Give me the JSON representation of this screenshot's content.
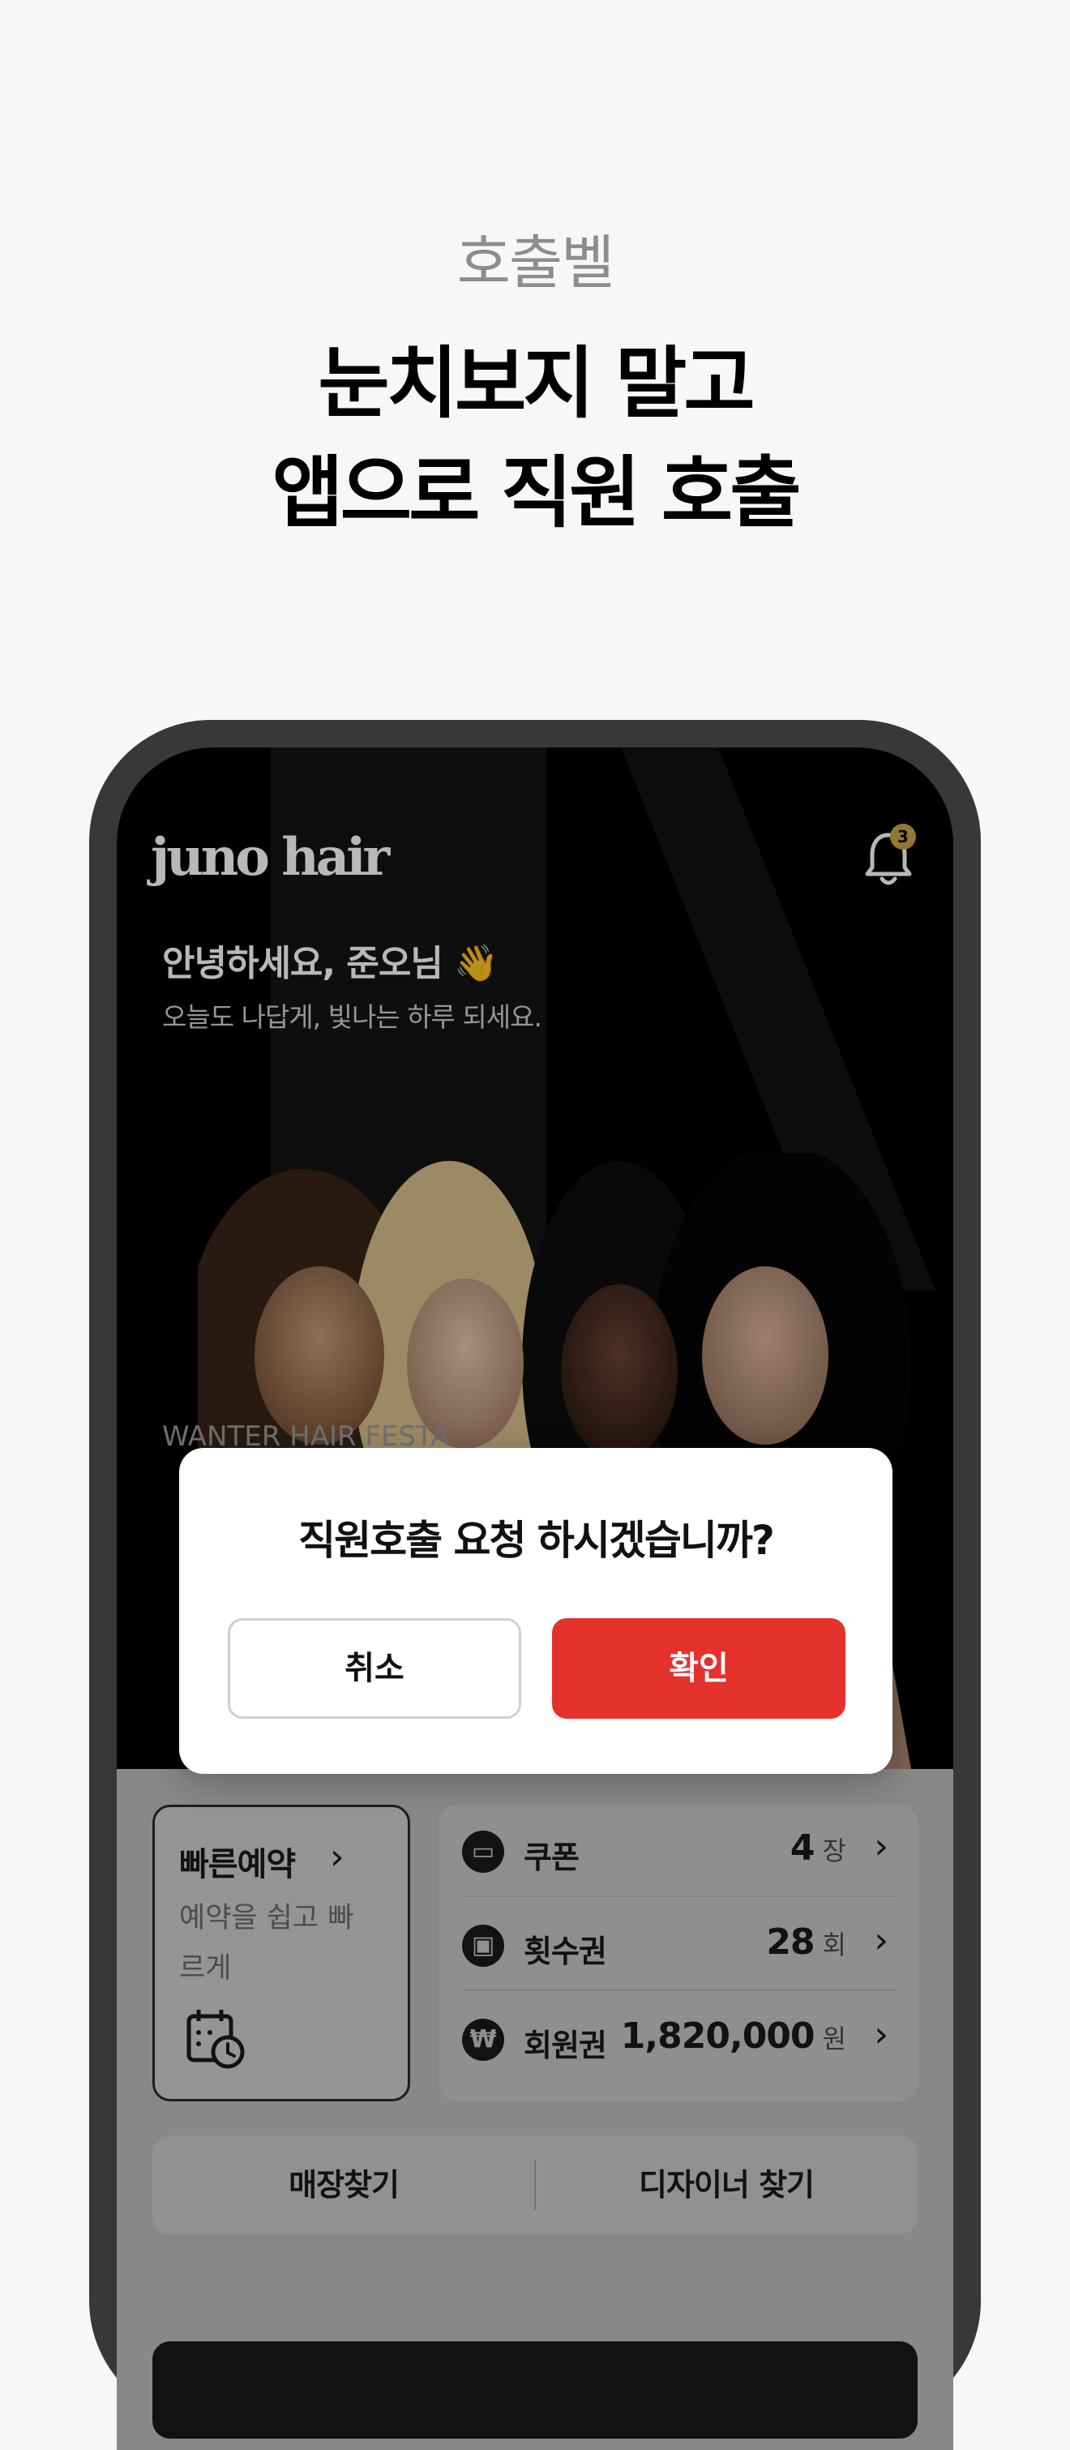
{
  "promo": {
    "eyebrow": "호출벨",
    "headline_line1": "눈치보지 말고",
    "headline_line2": "앱으로 직원 호출"
  },
  "app": {
    "brand": "juno hair",
    "notification_count": "3",
    "greeting": "안녕하세요, 준오님 👋",
    "subgreeting": "오늘도 나답게, 빛나는 하루 되세요.",
    "event_caption": "WANTER HAIR FESTA"
  },
  "quick_reserve": {
    "title": "빠른예약",
    "description": "예약을 쉽고 빠르게"
  },
  "wallet": [
    {
      "icon": "ticket-icon",
      "glyph": "▭",
      "label": "쿠폰",
      "value": "4",
      "unit": "장"
    },
    {
      "icon": "wallet-icon",
      "glyph": "▣",
      "label": "횟수권",
      "value": "28",
      "unit": "회"
    },
    {
      "icon": "won-icon",
      "glyph": "₩",
      "label": "회원권",
      "value": "1,820,000",
      "unit": "원"
    }
  ],
  "find": {
    "store": "매장찾기",
    "designer": "디자이너 찾기"
  },
  "dialog": {
    "title": "직원호출 요청 하시겠습니까?",
    "cancel": "취소",
    "confirm": "확인"
  },
  "colors": {
    "accent": "#e5312c",
    "badge": "#c9a449"
  }
}
